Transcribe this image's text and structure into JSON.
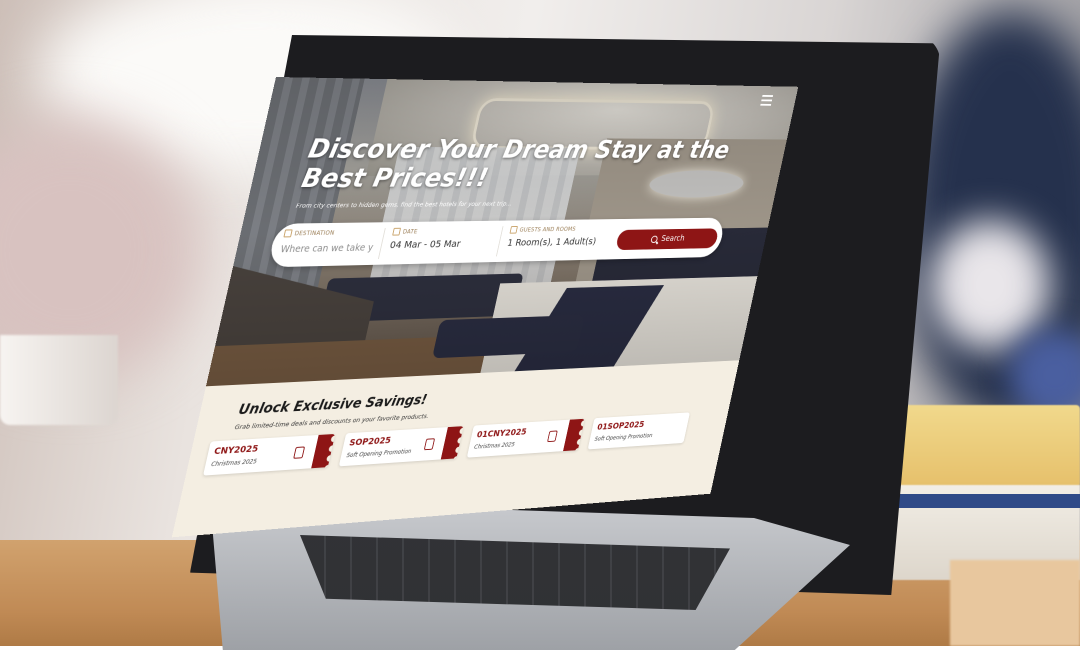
{
  "hero": {
    "title": "Discover Your Dream Stay at the Best Prices!!!",
    "subtitle": "From city centers to hidden gems, find the best hotels for your next trip..."
  },
  "search": {
    "destination_label": "DESTINATION",
    "destination_placeholder": "Where can we take you",
    "date_label": "DATE",
    "date_value": "04 Mar - 05 Mar",
    "guests_label": "GUESTS AND ROOMS",
    "guests_value": "1 Room(s), 1 Adult(s)",
    "button_label": "Search"
  },
  "promos": {
    "title": "Unlock Exclusive Savings!",
    "subtitle": "Grab limited-time deals and discounts on your favorite products.",
    "coupons": [
      {
        "code": "CNY2025",
        "description": "Christmas 2025"
      },
      {
        "code": "SOP2025",
        "description": "Soft Opening Promotion"
      },
      {
        "code": "01CNY2025",
        "description": "Christmas 2025"
      },
      {
        "code": "01SOP2025",
        "description": "Soft Opening Promotion"
      }
    ]
  },
  "colors": {
    "brand_red": "#8e1515",
    "accent_gold": "#c9a36a",
    "section_cream": "#f4eee2"
  },
  "icons": [
    "hamburger-menu-icon",
    "location-pin-icon",
    "calendar-icon",
    "people-icon",
    "search-icon",
    "copy-icon"
  ]
}
